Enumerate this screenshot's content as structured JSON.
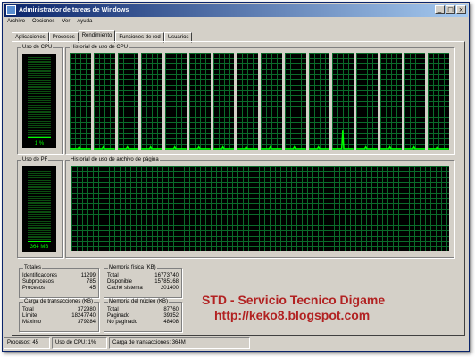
{
  "window": {
    "title": "Administrador de tareas de Windows"
  },
  "menu": [
    "Archivo",
    "Opciones",
    "Ver",
    "Ayuda"
  ],
  "tabs": [
    "Aplicaciones",
    "Procesos",
    "Rendimiento",
    "Funciones de red",
    "Usuarios"
  ],
  "active_tab": "Rendimiento",
  "cpu_usage": {
    "label": "Uso de CPU",
    "value": "1 %"
  },
  "cpu_history": {
    "label": "Historial de uso de CPU",
    "cores": 16
  },
  "pf_usage": {
    "label": "Uso de PF",
    "value": "364 MB"
  },
  "pf_history": {
    "label": "Historial de uso de archivo de página"
  },
  "totales": {
    "label": "Totales",
    "rows": [
      {
        "name": "Identificadores",
        "value": "11299"
      },
      {
        "name": "Subprocesos",
        "value": "785"
      },
      {
        "name": "Procesos",
        "value": "45"
      }
    ]
  },
  "memoria_fisica": {
    "label": "Memoria física (KB)",
    "rows": [
      {
        "name": "Total",
        "value": "16773740"
      },
      {
        "name": "Disponible",
        "value": "15785168"
      },
      {
        "name": "Caché sistema",
        "value": "201400"
      }
    ]
  },
  "carga_transacciones": {
    "label": "Carga de transacciones (KB)",
    "rows": [
      {
        "name": "Total",
        "value": "372980"
      },
      {
        "name": "Límite",
        "value": "18247740"
      },
      {
        "name": "Máximo",
        "value": "379284"
      }
    ]
  },
  "memoria_nucleo": {
    "label": "Memoria del núcleo (KB)",
    "rows": [
      {
        "name": "Total",
        "value": "87760"
      },
      {
        "name": "Paginado",
        "value": "39352"
      },
      {
        "name": "No paginado",
        "value": "48408"
      }
    ]
  },
  "overlay": {
    "line1": "STD - Servicio Tecnico Digame",
    "line2": "http://keko8.blogspot.com"
  },
  "status": {
    "procesos": "Procesos: 45",
    "cpu": "Uso de CPU: 1%",
    "carga": "Carga de transacciones: 364M"
  },
  "colors": {
    "title_start": "#0a246a",
    "graph_line": "#00ff00",
    "grid": "#0a6b2a"
  },
  "cpu_usage_percent": 1
}
